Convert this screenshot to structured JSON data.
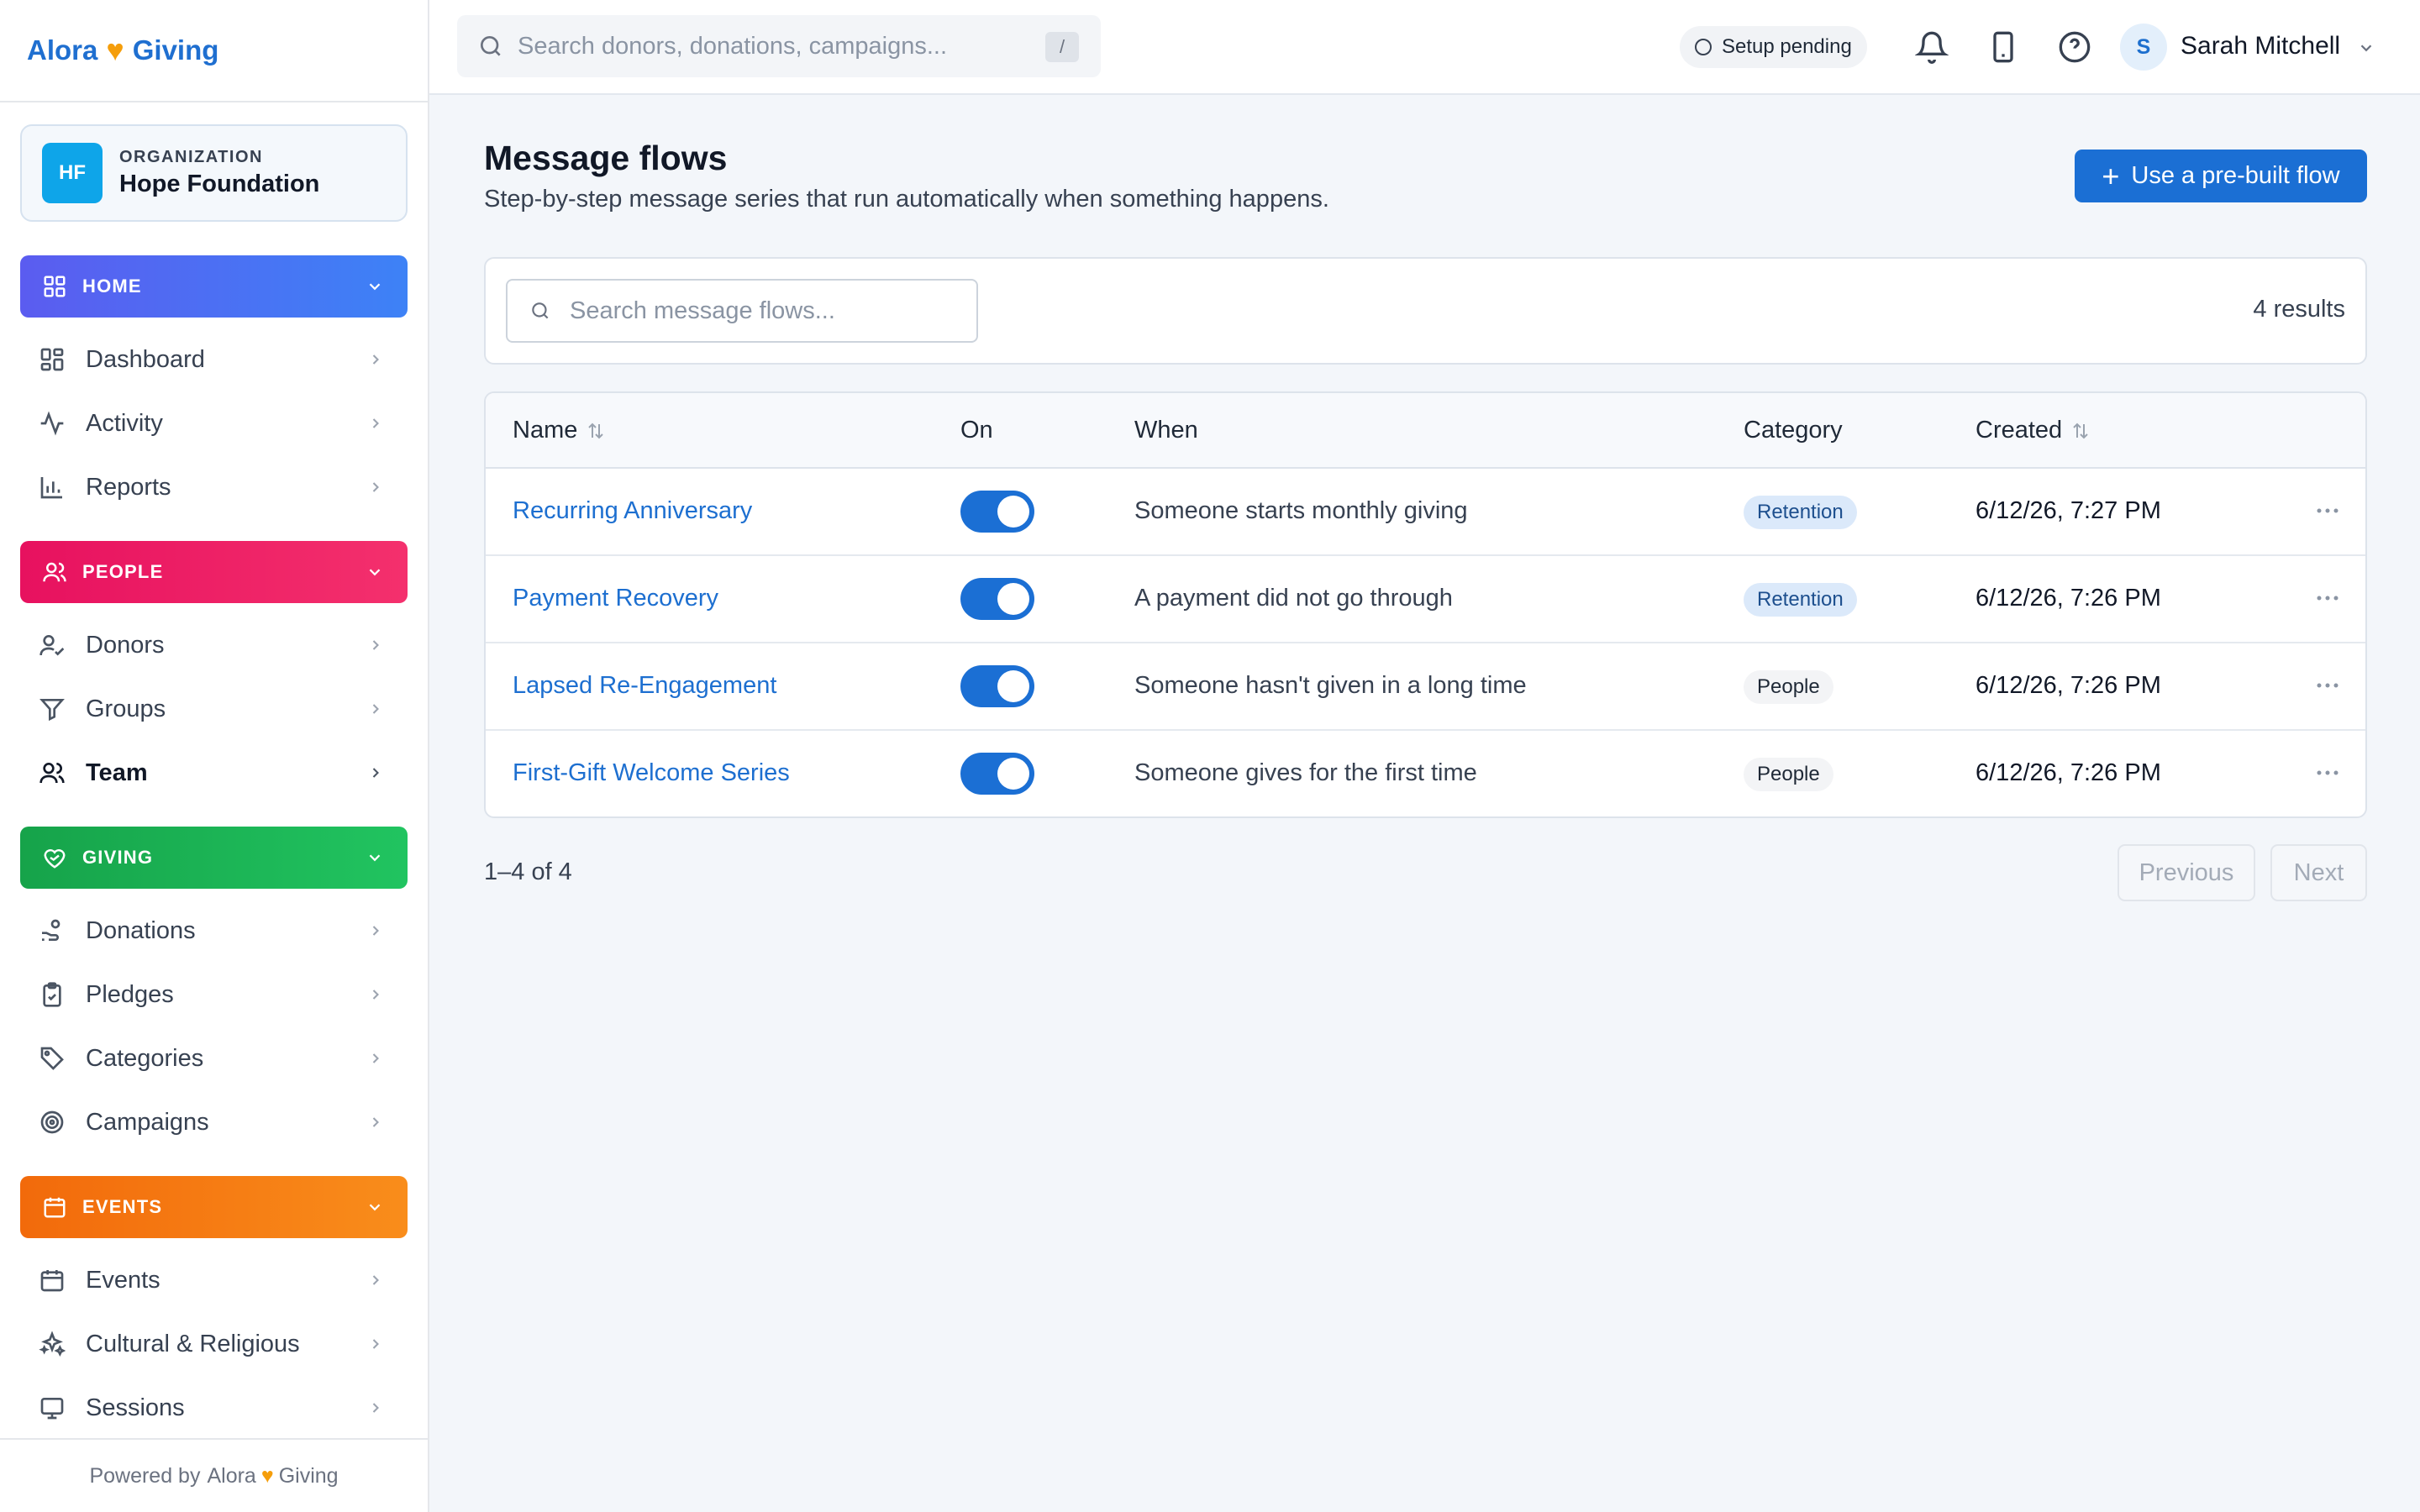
{
  "brand": {
    "name_left": "Alora",
    "name_right": "Giving"
  },
  "organization": {
    "label": "ORGANIZATION",
    "initials": "HF",
    "name": "Hope Foundation"
  },
  "sidebar": {
    "sections": [
      {
        "title": "HOME",
        "items": [
          "Dashboard",
          "Activity",
          "Reports"
        ]
      },
      {
        "title": "PEOPLE",
        "items": [
          "Donors",
          "Groups",
          "Team"
        ]
      },
      {
        "title": "GIVING",
        "items": [
          "Donations",
          "Pledges",
          "Categories",
          "Campaigns"
        ]
      },
      {
        "title": "EVENTS",
        "items": [
          "Events",
          "Cultural & Religious",
          "Sessions"
        ]
      }
    ],
    "footer": {
      "prefix": "Powered by",
      "brand_left": "Alora",
      "brand_right": "Giving"
    }
  },
  "topbar": {
    "search_placeholder": "Search donors, donations, campaigns...",
    "search_shortcut": "/",
    "setup_status": "Setup pending",
    "user": {
      "initial": "S",
      "name": "Sarah Mitchell"
    }
  },
  "page": {
    "title": "Message flows",
    "subtitle": "Step-by-step message series that run automatically when something happens.",
    "primary_action": "Use a pre-built flow",
    "search_placeholder": "Search message flows...",
    "results": "4 results"
  },
  "table": {
    "columns": {
      "name": "Name",
      "on": "On",
      "when": "When",
      "category": "Category",
      "created": "Created"
    },
    "rows": [
      {
        "name": "Recurring Anniversary",
        "on": true,
        "when": "Someone starts monthly giving",
        "category": "Retention",
        "created": "6/12/26, 7:27 PM"
      },
      {
        "name": "Payment Recovery",
        "on": true,
        "when": "A payment did not go through",
        "category": "Retention",
        "created": "6/12/26, 7:26 PM"
      },
      {
        "name": "Lapsed Re-Engagement",
        "on": true,
        "when": "Someone hasn't given in a long time",
        "category": "People",
        "created": "6/12/26, 7:26 PM"
      },
      {
        "name": "First-Gift Welcome Series",
        "on": true,
        "when": "Someone gives for the first time",
        "category": "People",
        "created": "6/12/26, 7:26 PM"
      }
    ]
  },
  "pagination": {
    "info": "1–4 of 4",
    "previous": "Previous",
    "next": "Next"
  },
  "colors": {
    "accent": "#1b6fd4",
    "home": "#5b5cf0",
    "people": "#e7115f",
    "giving": "#16a34a",
    "events": "#f26a0b",
    "brand_heart": "#f59e0b"
  }
}
